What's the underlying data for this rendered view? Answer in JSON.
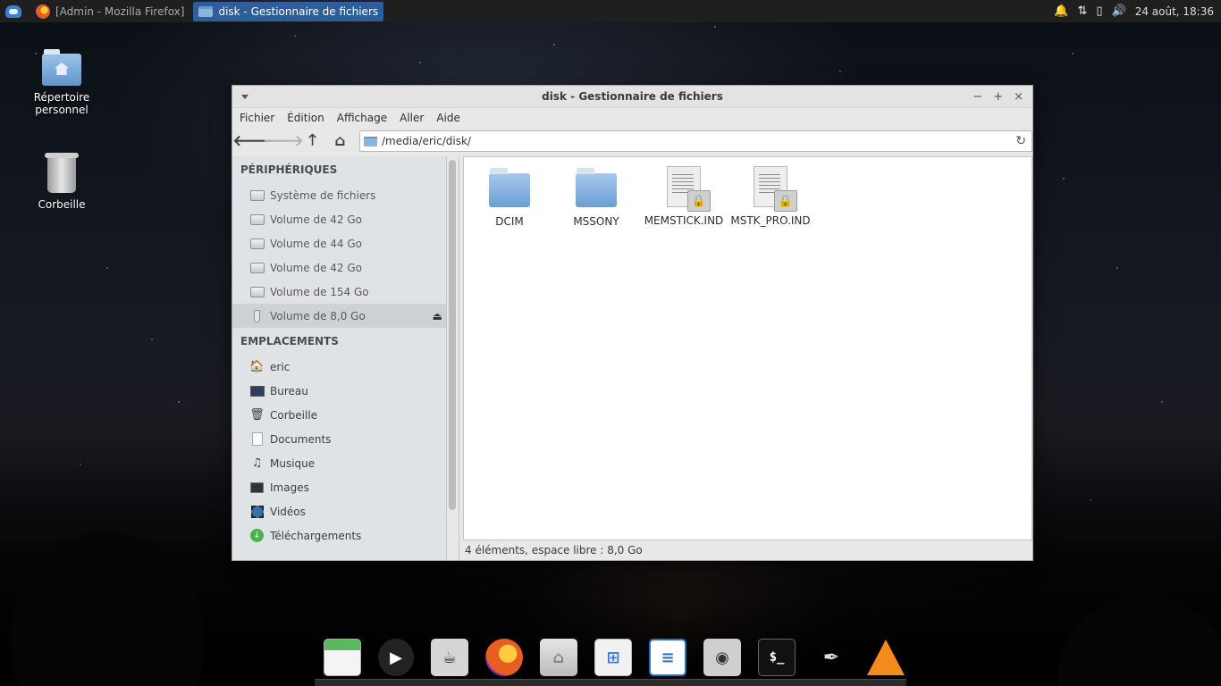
{
  "top_panel": {
    "tasks": [
      "[Admin - Mozilla Firefox]",
      "disk - Gestionnaire de fichiers"
    ],
    "clock": "24 août, 18:36"
  },
  "desktop": {
    "icons": [
      {
        "label": "Répertoire personnel",
        "icon": "home-folder-icon"
      },
      {
        "label": "Corbeille",
        "icon": "trash-icon"
      }
    ]
  },
  "window": {
    "title": "disk - Gestionnaire de fichiers",
    "menu": [
      "Fichier",
      "Édition",
      "Affichage",
      "Aller",
      "Aide"
    ],
    "path": "/media/eric/disk/",
    "sidebar": {
      "devices_header": "PÉRIPHÉRIQUES",
      "devices": [
        "Système de fichiers",
        "Volume de 42 Go",
        "Volume de 44 Go",
        "Volume de 42 Go",
        "Volume de 154 Go",
        "Volume de 8,0 Go"
      ],
      "places_header": "EMPLACEMENTS",
      "places": [
        "eric",
        "Bureau",
        "Corbeille",
        "Documents",
        "Musique",
        "Images",
        "Vidéos",
        "Téléchargements"
      ]
    },
    "files": [
      {
        "name": "DCIM",
        "type": "folder"
      },
      {
        "name": "MSSONY",
        "type": "folder"
      },
      {
        "name": "MEMSTICK.IND",
        "type": "locked-file"
      },
      {
        "name": "MSTK_PRO.IND",
        "type": "locked-file"
      }
    ],
    "status": "4 éléments, espace libre : 8,0 Go"
  },
  "dock": {
    "apps": [
      "calendar-icon",
      "media-player-icon",
      "settings-icon",
      "firefox-icon",
      "home-folder-icon",
      "software-store-icon",
      "text-editor-icon",
      "camera-icon",
      "terminal-icon",
      "inkscape-icon",
      "vlc-icon"
    ],
    "terminal_prompt": "$_"
  }
}
